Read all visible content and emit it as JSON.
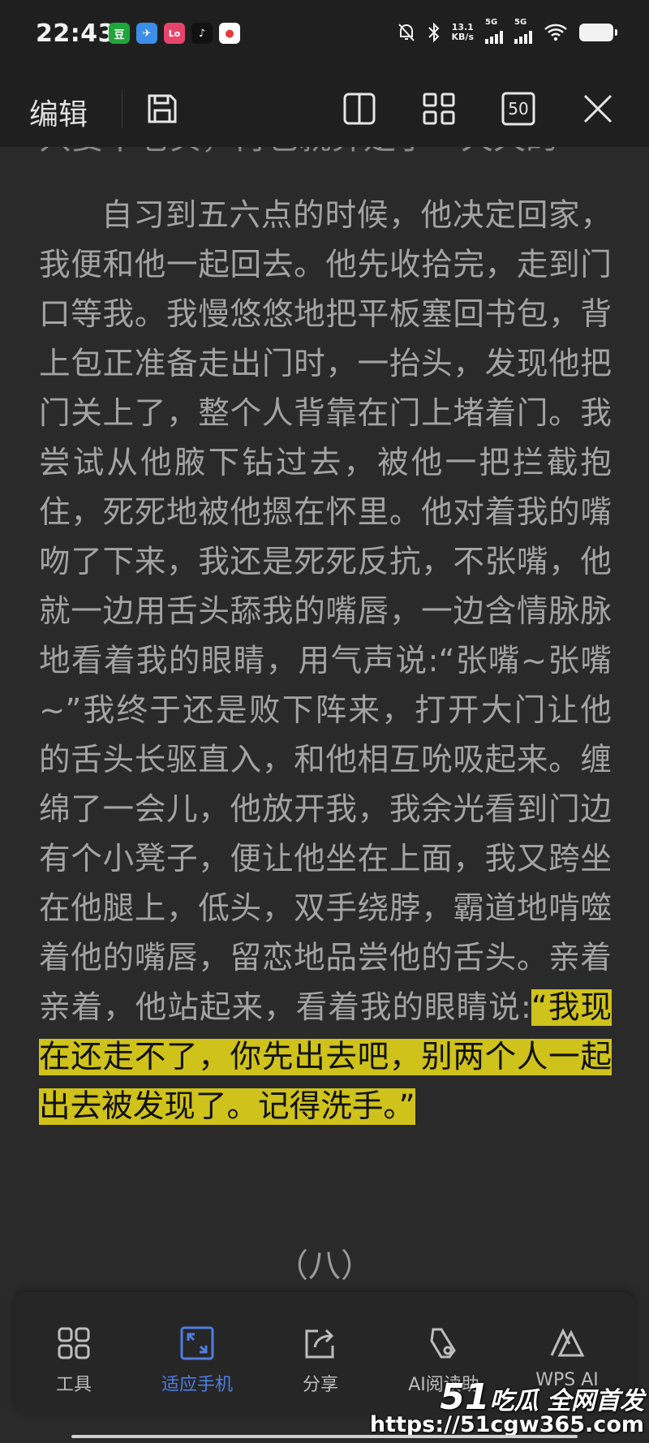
{
  "status": {
    "time": "22:43",
    "netspeed_value": "13.1",
    "netspeed_unit": "KB/s",
    "sim1": "5G",
    "sim2": "5G"
  },
  "apps": [
    {
      "name": "douban-app-icon",
      "label": "豆",
      "color": "#21a539"
    },
    {
      "name": "maps-app-icon",
      "label": "✈",
      "color": "#3c8ee8"
    },
    {
      "name": "lofter-app-icon",
      "label": "Lo",
      "color": "#e8456c"
    },
    {
      "name": "tiktok-app-icon",
      "label": "♪",
      "color": "#111111"
    },
    {
      "name": "location-app-icon",
      "label": "●",
      "color": "#e23b3b"
    }
  ],
  "toolbar": {
    "edit_label": "编辑",
    "page_count": "50"
  },
  "content": {
    "prev_line": "只要不老实，再也就算是了一天天的",
    "paragraph_text": "自习到五六点的时候，他决定回家，我便和他一起回去。他先收拾完，走到门口等我。我慢悠悠地把平板塞回书包，背上包正准备走出门时，一抬头，发现他把门关上了，整个人背靠在门上堵着门。我尝试从他腋下钻过去，被他一把拦截抱住，死死地被他摁在怀里。他对着我的嘴吻了下来，我还是死死反抗，不张嘴，他就一边用舌头舔我的嘴唇，一边含情脉脉地看着我的眼睛，用气声说:“张嘴~张嘴~”我终于还是败下阵来，打开大门让他的舌头长驱直入，和他相互吮吸起来。缠绵了一会儿，他放开我，我余光看到门边有个小凳子，便让他坐在上面，我又跨坐在他腿上，低头，双手绕脖，霸道地啃噬着他的嘴唇，留恋地品尝他的舌头。亲着亲着，他站起来，看着我的眼睛说:",
    "highlighted_text": "“我现在还走不了，你先出去吧，别两个人一起出去被发现了。记得洗手。”",
    "chapter_heading": "（八）"
  },
  "bottom_bar": {
    "items": [
      {
        "label": "工具"
      },
      {
        "label": "适应手机"
      },
      {
        "label": "分享"
      },
      {
        "label": "AI阅读助"
      },
      {
        "label": "WPS AI"
      }
    ],
    "active_color": "#4d7de0"
  },
  "watermark": {
    "brand_number": "51",
    "brand_text": "吃瓜 全网首发",
    "url": "https://51cgw365.com"
  },
  "colors": {
    "background": "#2a2a2a",
    "highlight": "#cfc21a",
    "text": "#a3a3a3"
  }
}
